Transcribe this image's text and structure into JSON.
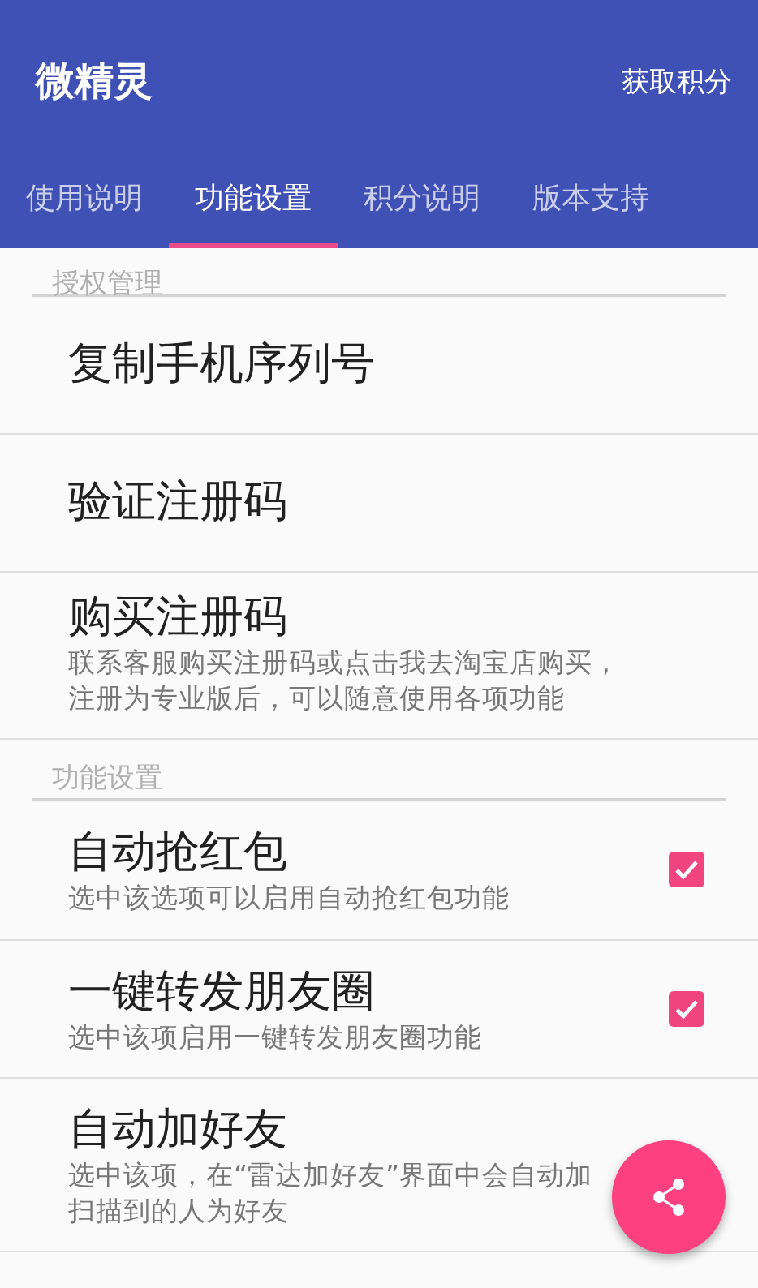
{
  "app_bar": {
    "title": "微精灵",
    "action": "获取积分"
  },
  "tabs": [
    {
      "label": "使用说明",
      "selected": false
    },
    {
      "label": "功能设置",
      "selected": true
    },
    {
      "label": "积分说明",
      "selected": false
    },
    {
      "label": "版本支持",
      "selected": false
    }
  ],
  "sections": [
    {
      "header": "授权管理",
      "items": [
        {
          "kind": "action",
          "title": "复制手机序列号"
        },
        {
          "kind": "action",
          "title": "验证注册码"
        },
        {
          "kind": "action",
          "title": "购买注册码",
          "description": [
            "联系客服购买注册码或点击我去淘宝店购买，注册为专业版后，可以随意使用各项功能"
          ]
        }
      ]
    },
    {
      "header": "功能设置",
      "items": [
        {
          "kind": "checkbox",
          "title": "自动抢红包",
          "description": [
            "选中该选项可以启用自动抢红包功能"
          ],
          "checked": true
        },
        {
          "kind": "checkbox",
          "title": "一键转发朋友圈",
          "description": [
            "选中该项启用一键转发朋友圈功能"
          ],
          "checked": true
        },
        {
          "kind": "action",
          "title": "自动加好友",
          "description": [
            "选中该项，在“雷达加好友”界面中会自动加",
            "扫描到的人为好友"
          ]
        }
      ]
    }
  ],
  "fab": {
    "kind": "share"
  }
}
